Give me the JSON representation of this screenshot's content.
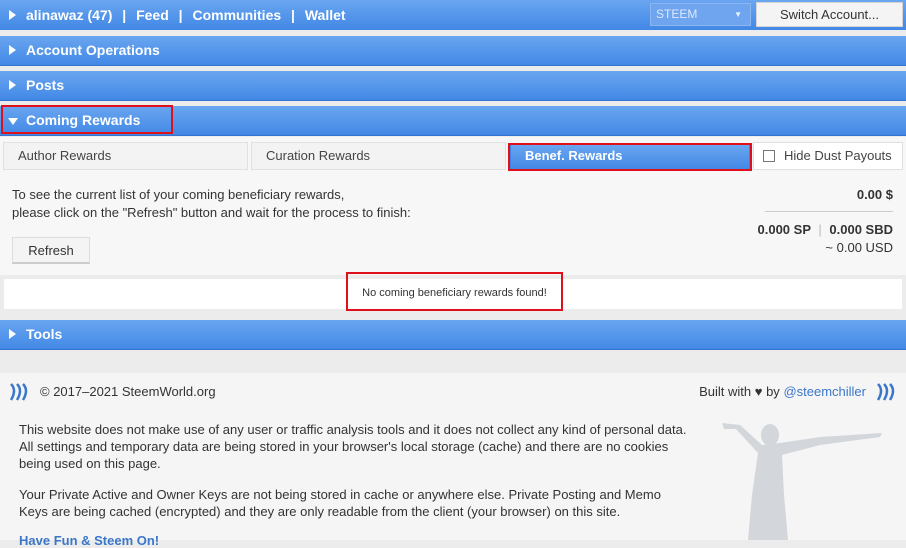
{
  "header": {
    "user": "alinawaz (47)",
    "nav": [
      "Feed",
      "Communities",
      "Wallet"
    ],
    "separator": "|",
    "coin_select": "STEEM",
    "switch_account": "Switch Account..."
  },
  "sections": {
    "account_operations": "Account Operations",
    "posts": "Posts",
    "coming_rewards": "Coming Rewards",
    "tools": "Tools"
  },
  "tabs": [
    "Author Rewards",
    "Curation Rewards",
    "Benef. Rewards"
  ],
  "hide_dust": "Hide Dust Payouts",
  "rewards": {
    "info_line1": "To see the current list of your coming beneficiary rewards,",
    "info_line2": "please click on the \"Refresh\" button and wait for the process to finish:",
    "refresh": "Refresh",
    "total_usd": "0.00 $",
    "sp": "0.000 SP",
    "sbd": "0.000 SBD",
    "approx_usd": "~ 0.00 USD",
    "empty_message": "No coming beneficiary rewards found!"
  },
  "footer": {
    "copyright": "© 2017–2021 SteemWorld.org",
    "built_with": "Built with ♥ by",
    "author_link": "@steemchiller",
    "para1": "This website does not make use of any user or traffic analysis tools and it does not collect any kind of personal data. All settings and temporary data are being stored in your browser's local storage (cache) and there are no cookies being used on this page.",
    "para2": "Your Private Active and Owner Keys are not being stored in cache or anywhere else. Private Posting and Memo Keys are being cached (encrypted) and they are only readable from the client (your browser) on this site.",
    "para3": "Have Fun & Steem On!"
  }
}
